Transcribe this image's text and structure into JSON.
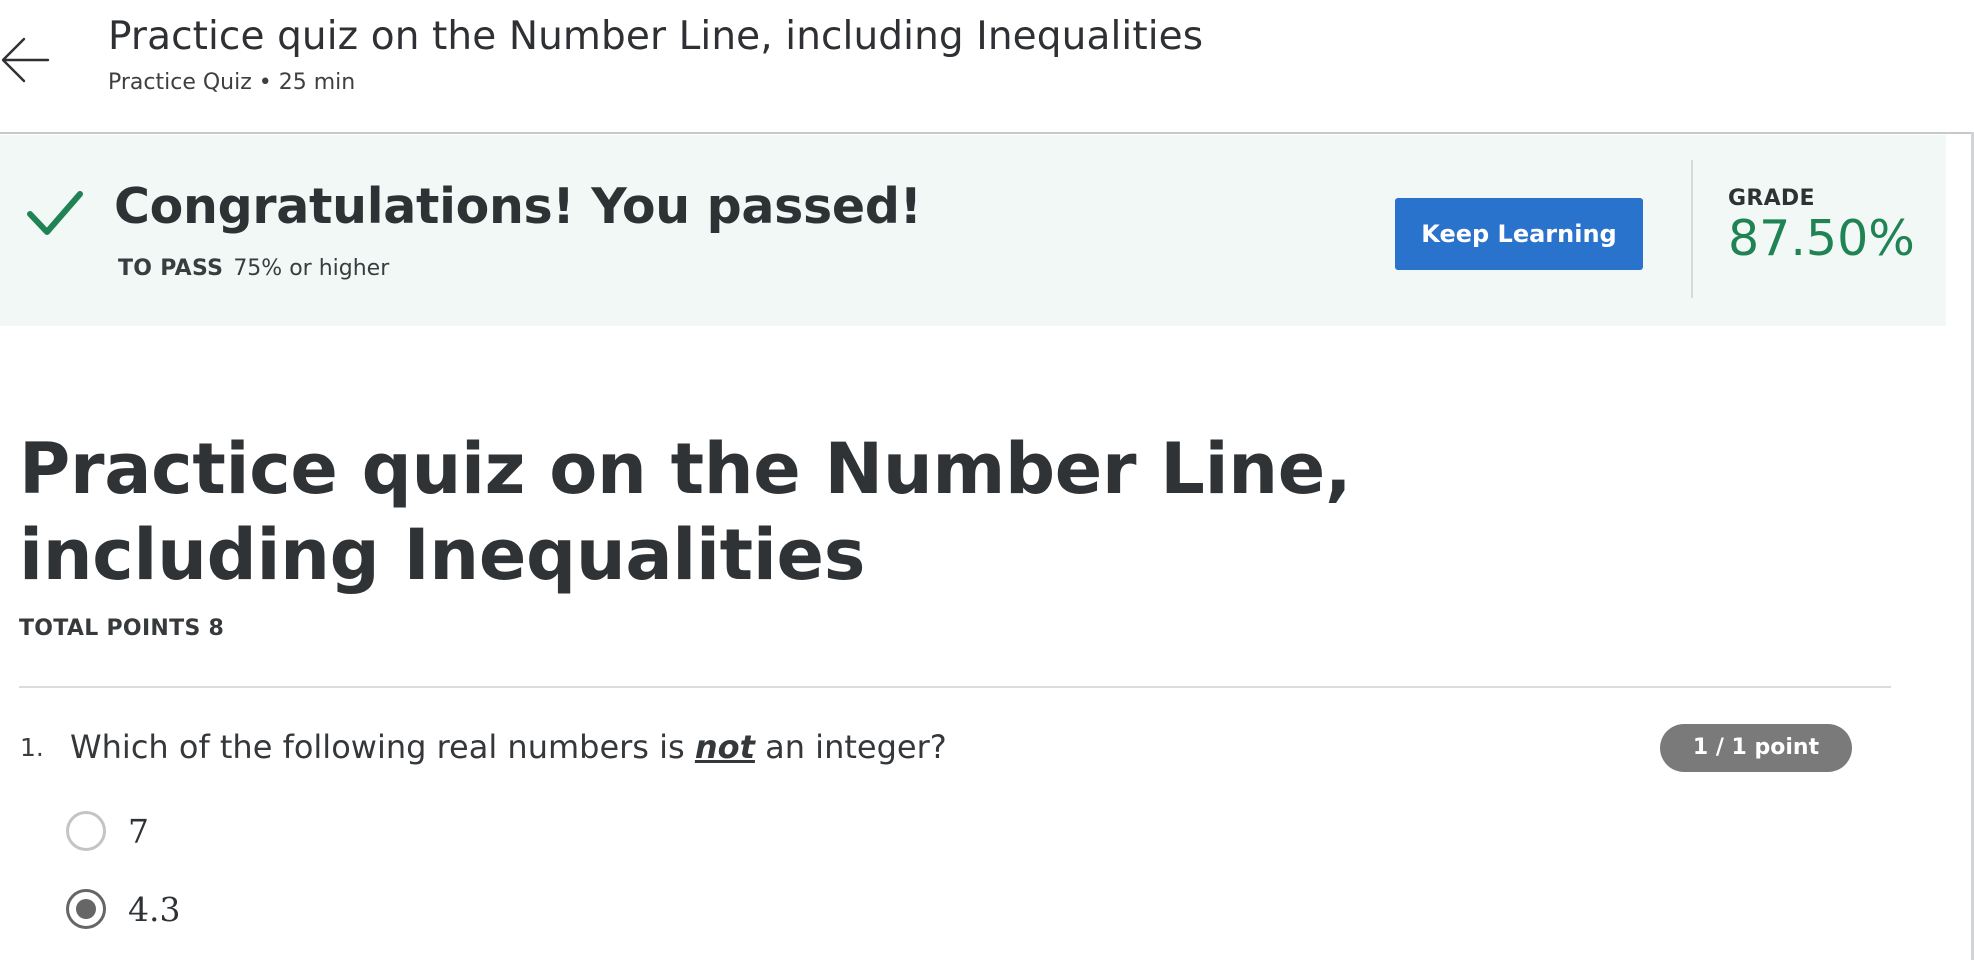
{
  "header": {
    "back_icon": "arrow-left-icon",
    "title": "Practice quiz on the Number Line, including Inequalities",
    "subtitle": "Practice Quiz • 25 min"
  },
  "result_banner": {
    "status_icon": "checkmark-icon",
    "message": "Congratulations! You passed!",
    "to_pass_label": "TO PASS",
    "to_pass_value": "75% or higher",
    "action_button": "Keep Learning",
    "grade_label": "GRADE",
    "grade_value": "87.50%",
    "colors": {
      "accent": "#2a73cc",
      "success": "#1f8354",
      "banner_bg": "#f2f8f6"
    }
  },
  "quiz": {
    "title": "Practice quiz on the Number Line, including Inequalities",
    "total_points": "TOTAL POINTS 8"
  },
  "questions": [
    {
      "number": "1.",
      "text_before": "Which of the following real numbers is ",
      "text_emphasis": "not",
      "text_after": " an integer?",
      "points": "1 / 1 point",
      "options": [
        {
          "label": "7",
          "selected": false
        },
        {
          "label": "4.3",
          "selected": true
        }
      ]
    }
  ]
}
